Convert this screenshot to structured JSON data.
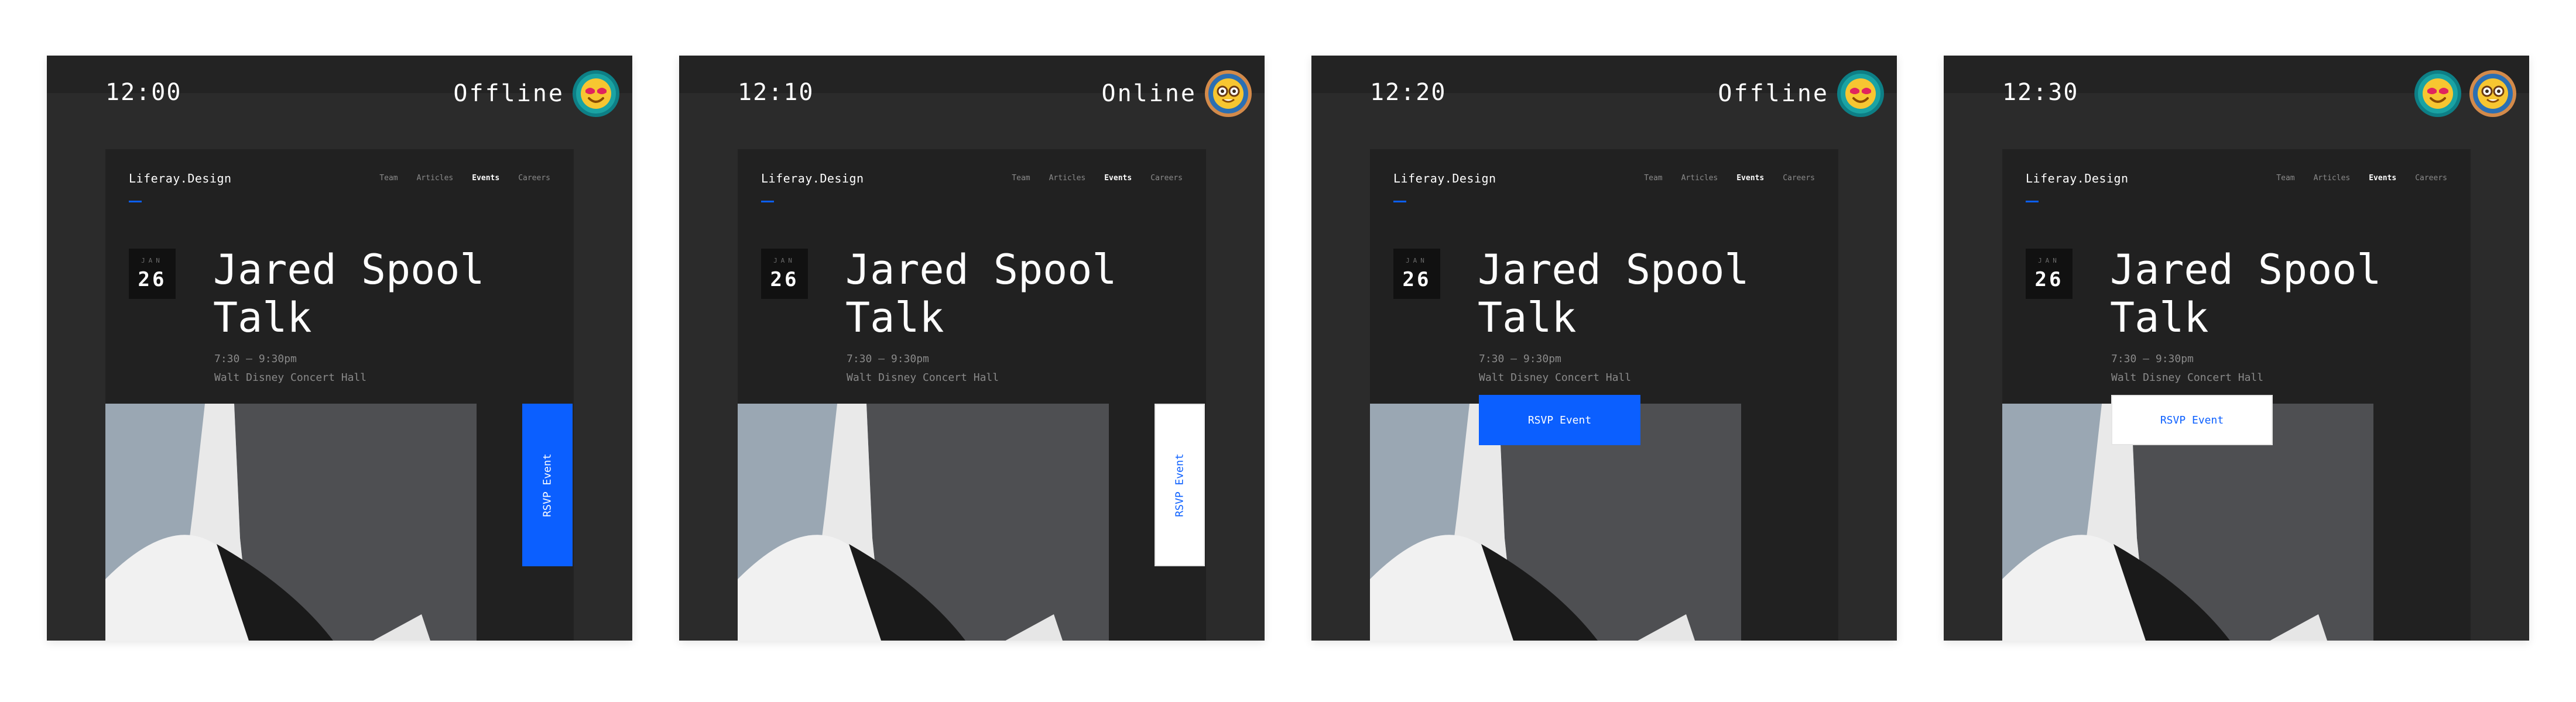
{
  "colors": {
    "accent": "#0b5fff",
    "panel_bg": "#2b2b2b",
    "device_bg": "#212121"
  },
  "panels": [
    {
      "time": "12:00",
      "status": "Offline",
      "avatars": [
        "cool-emoji-avatar"
      ],
      "rsvp_style": "vertical-blue",
      "nav": {
        "brand": "Liferay.Design",
        "links": [
          "Team",
          "Articles",
          "Events",
          "Careers"
        ],
        "active": "Events"
      },
      "event": {
        "month": "JAN",
        "day": "26",
        "title_line1": "Jared Spool",
        "title_line2": "Talk",
        "time": "7:30 — 9:30pm",
        "venue": "Walt Disney Concert Hall",
        "rsvp_label": "RSVP Event"
      }
    },
    {
      "time": "12:10",
      "status": "Online",
      "avatars": [
        "nerd-emoji-avatar"
      ],
      "rsvp_style": "vertical-white",
      "nav": {
        "brand": "Liferay.Design",
        "links": [
          "Team",
          "Articles",
          "Events",
          "Careers"
        ],
        "active": "Events"
      },
      "event": {
        "month": "JAN",
        "day": "26",
        "title_line1": "Jared Spool",
        "title_line2": "Talk",
        "time": "7:30 — 9:30pm",
        "venue": "Walt Disney Concert Hall",
        "rsvp_label": "RSVP Event"
      }
    },
    {
      "time": "12:20",
      "status": "Offline",
      "avatars": [
        "cool-emoji-avatar"
      ],
      "rsvp_style": "horizontal-blue",
      "nav": {
        "brand": "Liferay.Design",
        "links": [
          "Team",
          "Articles",
          "Events",
          "Careers"
        ],
        "active": "Events"
      },
      "event": {
        "month": "JAN",
        "day": "26",
        "title_line1": "Jared Spool",
        "title_line2": "Talk",
        "time": "7:30 — 9:30pm",
        "venue": "Walt Disney Concert Hall",
        "rsvp_label": "RSVP Event"
      }
    },
    {
      "time": "12:30",
      "status": "",
      "avatars": [
        "cool-emoji-avatar",
        "nerd-emoji-avatar"
      ],
      "rsvp_style": "horizontal-white",
      "nav": {
        "brand": "Liferay.Design",
        "links": [
          "Team",
          "Articles",
          "Events",
          "Careers"
        ],
        "active": "Events"
      },
      "event": {
        "month": "JAN",
        "day": "26",
        "title_line1": "Jared Spool",
        "title_line2": "Talk",
        "time": "7:30 — 9:30pm",
        "venue": "Walt Disney Concert Hall",
        "rsvp_label": "RSVP Event"
      }
    }
  ]
}
